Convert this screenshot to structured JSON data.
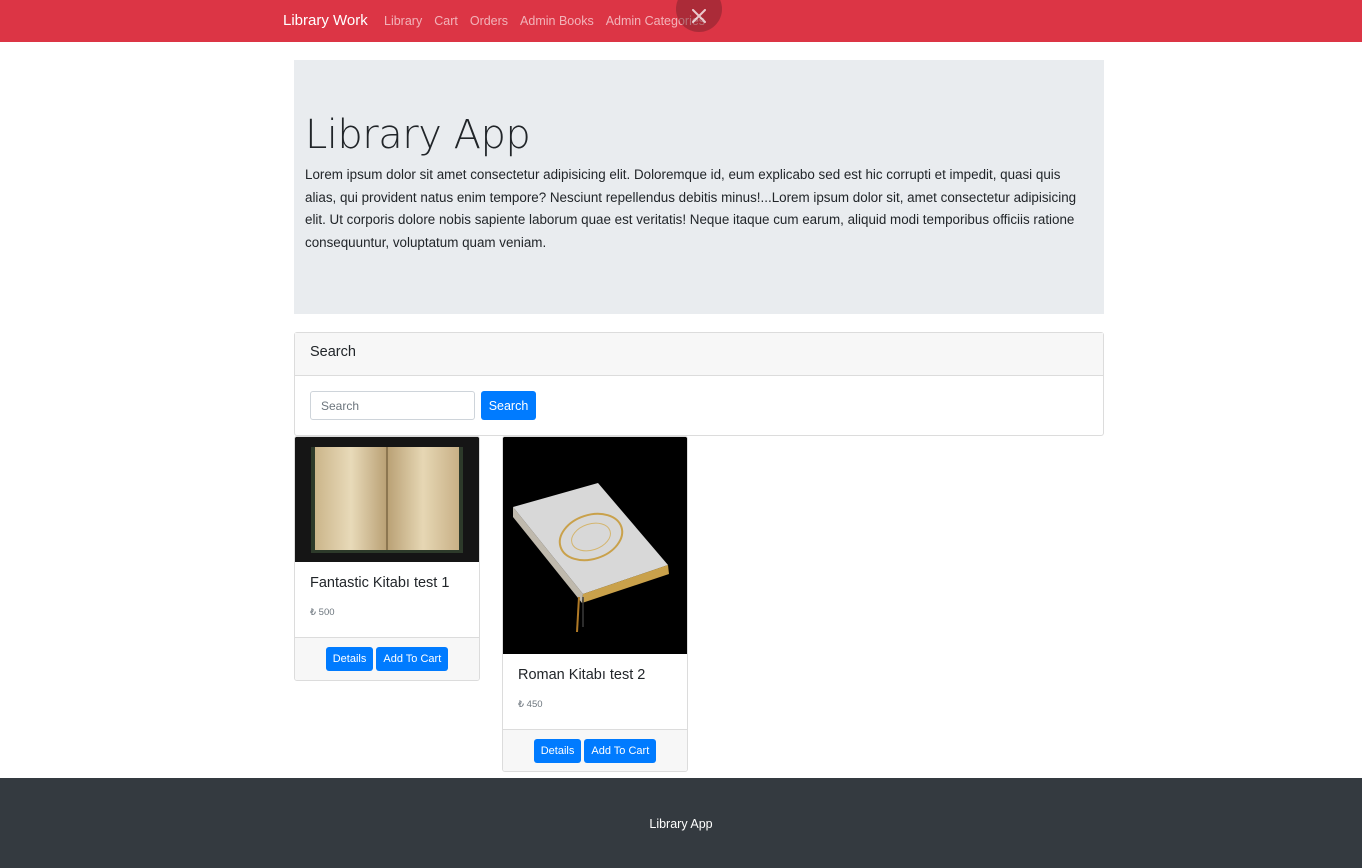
{
  "navbar": {
    "brand": "Library Work",
    "links": [
      "Library",
      "Cart",
      "Orders",
      "Admin Books",
      "Admin Categories"
    ],
    "close_icon": "close-icon",
    "color": "#dc3545"
  },
  "jumbotron": {
    "title": "Library App",
    "text": "Lorem ipsum dolor sit amet consectetur adipisicing elit. Doloremque id, eum explicabo sed est hic corrupti et impedit, quasi quis alias, qui provident natus enim tempore? Nesciunt repellendus debitis minus!...Lorem ipsum dolor sit, amet consectetur adipisicing elit. Ut corporis dolore nobis sapiente laborum quae est veritatis! Neque itaque cum earum, aliquid modi temporibus officiis ratione consequuntur, voluptatum quam veniam."
  },
  "search": {
    "header": "Search",
    "placeholder": "Search",
    "button": "Search"
  },
  "books": [
    {
      "title": "Fantastic Kitabı test 1",
      "price": "₺ 500",
      "details_label": "Details",
      "cart_label": "Add To Cart"
    },
    {
      "title": "Roman Kitabı test 2",
      "price": "₺ 450",
      "details_label": "Details",
      "cart_label": "Add To Cart"
    }
  ],
  "footer": {
    "text": "Library App"
  },
  "colors": {
    "primary": "#007bff",
    "danger": "#dc3545",
    "dark": "#343a40",
    "jumbotron": "#e9ecef"
  }
}
